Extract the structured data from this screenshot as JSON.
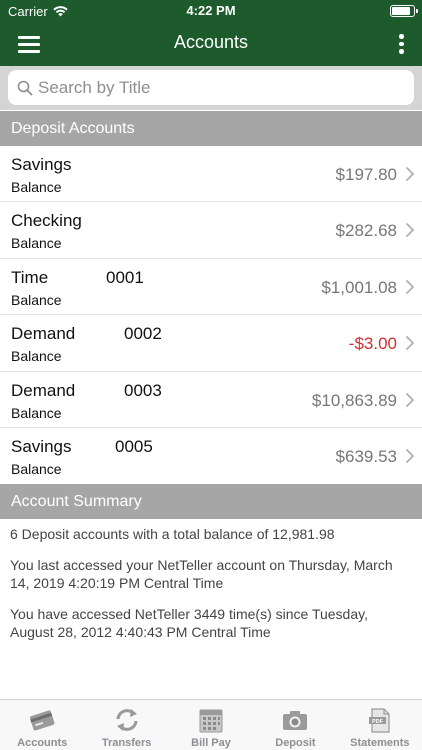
{
  "status_bar": {
    "carrier": "Carrier",
    "time": "4:22 PM",
    "battery_level": 0.9
  },
  "nav": {
    "title": "Accounts",
    "menu_icon": "hamburger-menu-icon",
    "more_icon": "vertical-ellipsis-icon"
  },
  "search": {
    "placeholder": "Search by Title",
    "value": ""
  },
  "deposit_section": {
    "title": "Deposit Accounts"
  },
  "accounts": [
    {
      "name": "Savings",
      "number": "",
      "sub": "Balance",
      "amount": "$197.80",
      "negative": false
    },
    {
      "name": "Checking",
      "number": "",
      "sub": "Balance",
      "amount": "$282.68",
      "negative": false
    },
    {
      "name": "Time",
      "number": "0001",
      "sub": "Balance",
      "amount": "$1,001.08",
      "negative": false
    },
    {
      "name": "Demand",
      "number": "0002",
      "sub": "Balance",
      "amount": "-$3.00",
      "negative": true
    },
    {
      "name": "Demand",
      "number": "0003",
      "sub": "Balance",
      "amount": "$10,863.89",
      "negative": false
    },
    {
      "name": "Savings",
      "number": "0005",
      "sub": "Balance",
      "amount": "$639.53",
      "negative": false
    }
  ],
  "summary_section": {
    "title": "Account Summary",
    "line1": "6 Deposit accounts with a total balance of 12,981.98",
    "line2": "You last accessed your NetTeller account on Thursday, March 14, 2019 4:20:19 PM Central Time",
    "line3": "You have accessed NetTeller 3449 time(s) since Tuesday, August 28, 2012 4:40:43 PM Central Time"
  },
  "tabs": [
    {
      "label": "Accounts",
      "icon": "card-icon"
    },
    {
      "label": "Transfers",
      "icon": "transfer-arrows-icon"
    },
    {
      "label": "Bill Pay",
      "icon": "calendar-icon"
    },
    {
      "label": "Deposit",
      "icon": "camera-icon"
    },
    {
      "label": "Statements",
      "icon": "pdf-document-icon"
    }
  ],
  "colors": {
    "header_green": "#1d5a2c",
    "section_gray": "#a6a6a6",
    "negative_red": "#d0302f"
  }
}
